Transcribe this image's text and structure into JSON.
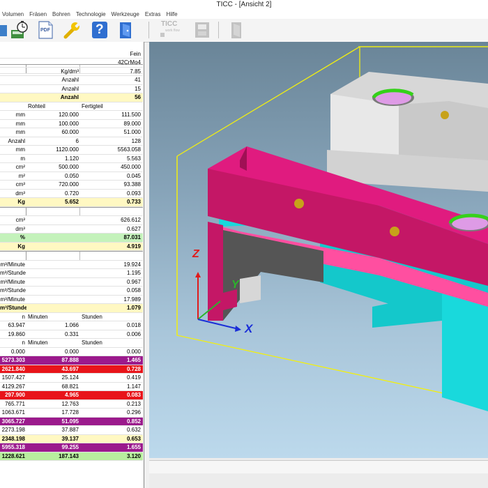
{
  "window": {
    "title": "TICC - [Ansicht 2]"
  },
  "menu": [
    "Volumen",
    "Fräsen",
    "Bohren",
    "Technologie",
    "Werkzeuge",
    "Extras",
    "Hilfe"
  ],
  "toolbar": {
    "icons": [
      "calculator-timer-icon",
      "pdf-icon",
      "wrench-icon",
      "help-icon",
      "exit-door-icon",
      "ticc-workflow-icon",
      "device-icon",
      "door-icon"
    ],
    "pdf_label": "PDF",
    "help_label": "?",
    "ticc_label": "TICC",
    "workflow_label": "work flow"
  },
  "table": {
    "rows": [
      {
        "t": "sec",
        "c": [
          "",
          "",
          ""
        ]
      },
      {
        "t": "",
        "c": [
          "",
          "",
          "Fein"
        ]
      },
      {
        "t": "",
        "c": [
          "",
          "",
          "42CrMo4"
        ]
      },
      {
        "t": "",
        "c": [
          "",
          "Kg/dm³",
          "7.85"
        ]
      },
      {
        "t": "",
        "c": [
          "",
          "Anzahl",
          "41"
        ]
      },
      {
        "t": "",
        "c": [
          "",
          "Anzahl",
          "15"
        ]
      },
      {
        "t": "yellow b",
        "c": [
          "",
          "Anzahl",
          "56"
        ]
      },
      {
        "t": "hdr",
        "c": [
          "",
          "Rohteil",
          "Fertigteil"
        ]
      },
      {
        "t": "",
        "c": [
          "mm",
          "120.000",
          "111.500"
        ]
      },
      {
        "t": "",
        "c": [
          "mm",
          "100.000",
          "89.000"
        ]
      },
      {
        "t": "",
        "c": [
          "mm",
          "60.000",
          "51.000"
        ]
      },
      {
        "t": "",
        "c": [
          "Anzahl",
          "6",
          "128"
        ]
      },
      {
        "t": "",
        "c": [
          "mm",
          "1120.000",
          "5563.058"
        ]
      },
      {
        "t": "",
        "c": [
          "m",
          "1.120",
          "5.563"
        ]
      },
      {
        "t": "",
        "c": [
          "cm²",
          "500.000",
          "450.000"
        ]
      },
      {
        "t": "",
        "c": [
          "m²",
          "0.050",
          "0.045"
        ]
      },
      {
        "t": "",
        "c": [
          "cm³",
          "720.000",
          "93.388"
        ]
      },
      {
        "t": "",
        "c": [
          "dm³",
          "0.720",
          "0.093"
        ]
      },
      {
        "t": "yellow b",
        "c": [
          "Kg",
          "5.652",
          "0.733"
        ]
      },
      {
        "t": "sec",
        "c": [
          "",
          "",
          ""
        ]
      },
      {
        "t": "",
        "c": [
          "cm³",
          "",
          "626.612"
        ]
      },
      {
        "t": "",
        "c": [
          "dm³",
          "",
          "0.627"
        ]
      },
      {
        "t": "green b",
        "c": [
          "%",
          "",
          "87.031"
        ]
      },
      {
        "t": "yellow b",
        "c": [
          "Kg",
          "",
          "4.919"
        ]
      },
      {
        "t": "sec",
        "c": [
          "",
          "",
          ""
        ]
      },
      {
        "t": "",
        "c": [
          "m³/Minute",
          "",
          "19.924"
        ]
      },
      {
        "t": "",
        "c": [
          "m³/Stunde",
          "",
          "1.195"
        ]
      },
      {
        "t": "",
        "c": [
          "m³/Minute",
          "",
          "0.967"
        ]
      },
      {
        "t": "",
        "c": [
          "m³/Stunde",
          "",
          "0.058"
        ]
      },
      {
        "t": "",
        "c": [
          "m³/Minute",
          "",
          "17.989"
        ]
      },
      {
        "t": "yellow b",
        "c": [
          "m³/Stunde",
          "",
          "1.079"
        ]
      },
      {
        "t": "hdr",
        "c": [
          "n",
          "Minuten",
          "Stunden"
        ]
      },
      {
        "t": "",
        "c": [
          "63.947",
          "1.066",
          "0.018"
        ]
      },
      {
        "t": "",
        "c": [
          "19.860",
          "0.331",
          "0.006"
        ]
      },
      {
        "t": "hdr",
        "c": [
          "n",
          "Minuten",
          "Stunden"
        ]
      },
      {
        "t": "",
        "c": [
          "0.000",
          "0.000",
          "0.000"
        ]
      },
      {
        "t": "purple",
        "c": [
          "5273.303",
          "87.888",
          "1.465"
        ]
      },
      {
        "t": "red",
        "c": [
          "2621.840",
          "43.697",
          "0.728"
        ]
      },
      {
        "t": "",
        "c": [
          "1507.427",
          "25.124",
          "0.419"
        ]
      },
      {
        "t": "",
        "c": [
          "4129.267",
          "68.821",
          "1.147"
        ]
      },
      {
        "t": "red",
        "c": [
          "297.900",
          "4.965",
          "0.083"
        ]
      },
      {
        "t": "",
        "c": [
          "765.771",
          "12.763",
          "0.213"
        ]
      },
      {
        "t": "",
        "c": [
          "1063.671",
          "17.728",
          "0.296"
        ]
      },
      {
        "t": "purple",
        "c": [
          "3065.727",
          "51.095",
          "0.852"
        ]
      },
      {
        "t": "",
        "c": [
          "2273.198",
          "37.887",
          "0.632"
        ]
      },
      {
        "t": "yellow b",
        "c": [
          "2348.198",
          "39.137",
          "0.653"
        ]
      },
      {
        "t": "purple",
        "c": [
          "5955.318",
          "99.255",
          "1.655"
        ]
      },
      {
        "t": "lgreen",
        "c": [
          "1228.621",
          "187.143",
          "3.120"
        ]
      }
    ]
  },
  "viewport": {
    "axis_labels": {
      "z": "Z",
      "y": "Y",
      "x": "X"
    },
    "colors": {
      "magenta": "#c41766",
      "cyan": "#19d9dc",
      "grey": "#d4d4d4",
      "bbox": "#f2ef10"
    }
  }
}
